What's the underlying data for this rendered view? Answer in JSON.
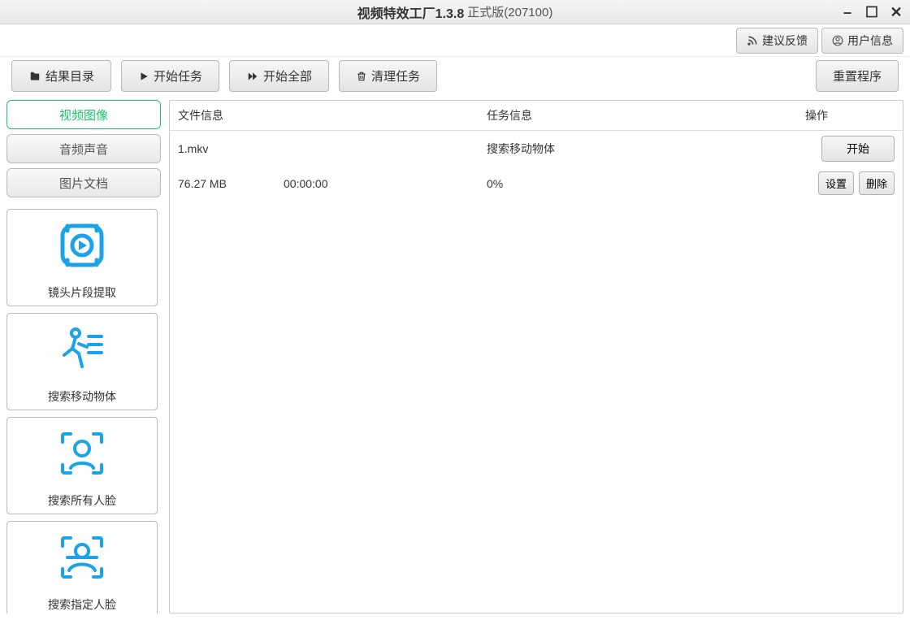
{
  "window": {
    "title_main": "视频特效工厂1.3.8",
    "title_sub": "正式版(207100)"
  },
  "topbar": {
    "feedback": "建议反馈",
    "user_info": "用户信息"
  },
  "toolbar": {
    "results_dir": "结果目录",
    "start_task": "开始任务",
    "start_all": "开始全部",
    "clear_tasks": "清理任务",
    "reset_program": "重置程序"
  },
  "sidebar": {
    "tabs": {
      "video_image": "视频图像",
      "audio_sound": "音频声音",
      "image_document": "图片文档"
    },
    "tools": [
      {
        "label": "镜头片段提取"
      },
      {
        "label": "搜索移动物体"
      },
      {
        "label": "搜索所有人脸"
      },
      {
        "label": "搜索指定人脸"
      }
    ]
  },
  "columns": {
    "file_info": "文件信息",
    "task_info": "任务信息",
    "operations": "操作"
  },
  "tasks": [
    {
      "filename": "1.mkv",
      "task_name": "搜索移动物体",
      "size": "76.27 MB",
      "time": "00:00:00",
      "progress": "0%",
      "start_label": "开始",
      "settings_label": "设置",
      "delete_label": "删除"
    }
  ],
  "colors": {
    "accent_blue": "#1aa3e8",
    "accent_green": "#1fbf6e"
  }
}
